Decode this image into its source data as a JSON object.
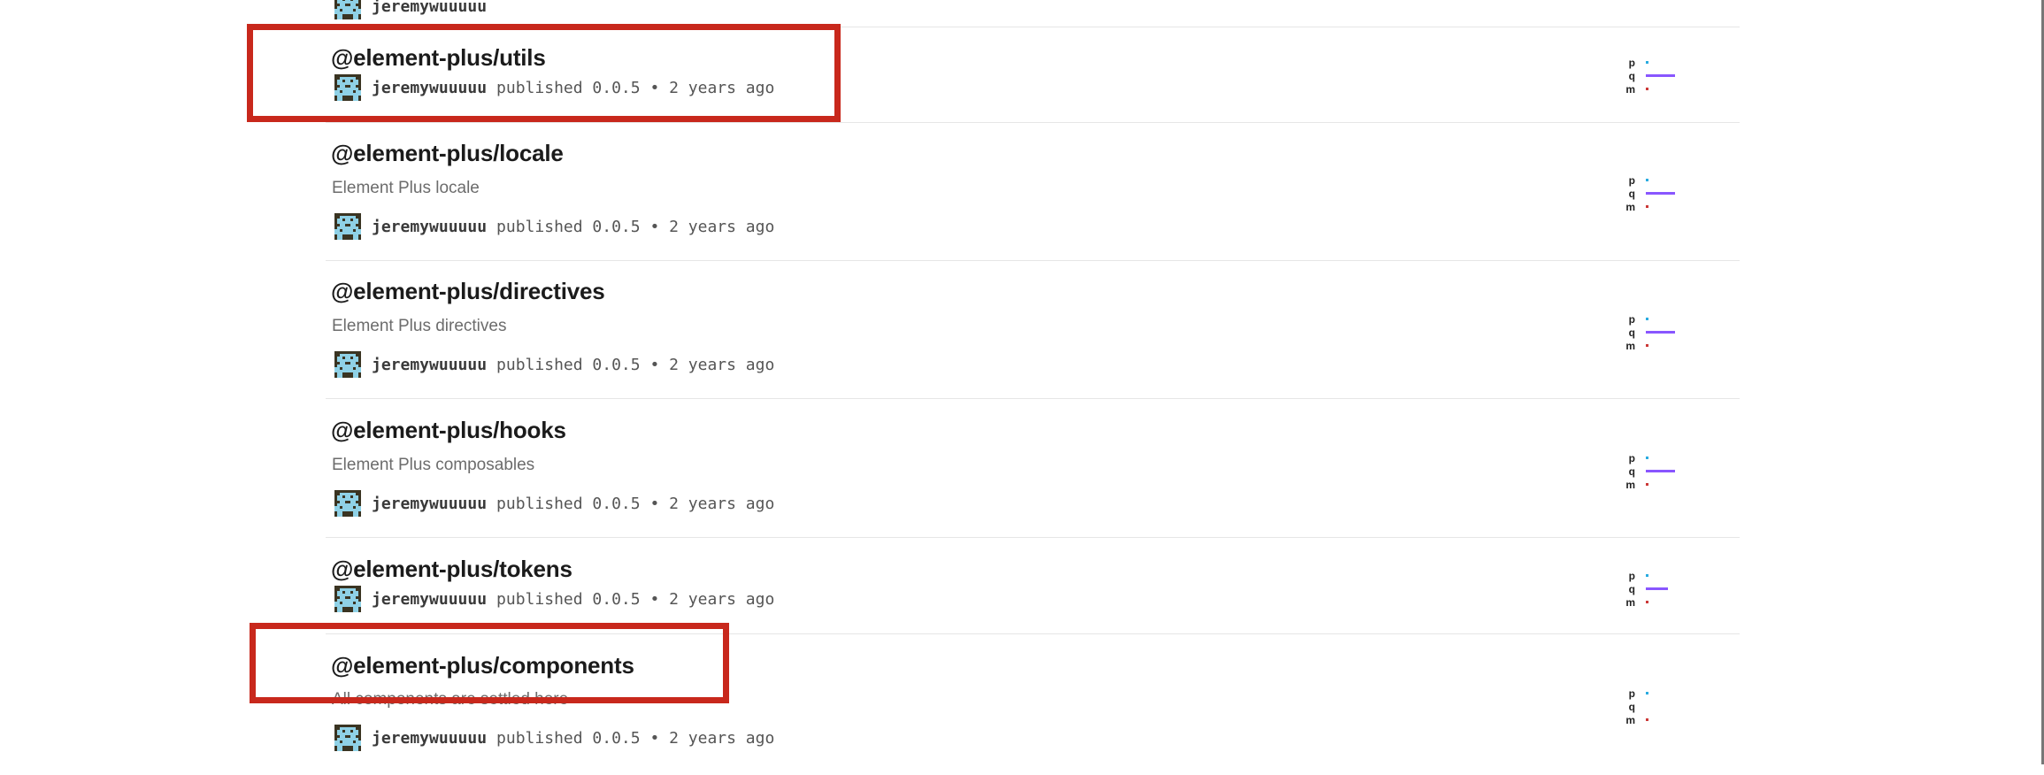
{
  "scores_legend": {
    "p": "p",
    "q": "q",
    "m": "m"
  },
  "colors": {
    "popularity": "#29abe0",
    "quality": "#8956ff",
    "maintenance": "#cb3837",
    "callout": "#c8281c"
  },
  "top_partial_row": {
    "publisher": "jeremywuuuuu"
  },
  "packages": [
    {
      "name": "@element-plus/utils",
      "description": "",
      "publisher": "jeremywuuuuu",
      "published_text": "published 0.0.5 • 2 years ago",
      "scores": {
        "p": 0.05,
        "q": 0.55,
        "m": 0.03
      }
    },
    {
      "name": "@element-plus/locale",
      "description": "Element Plus locale",
      "publisher": "jeremywuuuuu",
      "published_text": "published 0.0.5 • 2 years ago",
      "scores": {
        "p": 0.05,
        "q": 0.55,
        "m": 0.03
      }
    },
    {
      "name": "@element-plus/directives",
      "description": "Element Plus directives",
      "publisher": "jeremywuuuuu",
      "published_text": "published 0.0.5 • 2 years ago",
      "scores": {
        "p": 0.05,
        "q": 0.55,
        "m": 0.03
      }
    },
    {
      "name": "@element-plus/hooks",
      "description": "Element Plus composables",
      "publisher": "jeremywuuuuu",
      "published_text": "published 0.0.5 • 2 years ago",
      "scores": {
        "p": 0.05,
        "q": 0.55,
        "m": 0.03
      }
    },
    {
      "name": "@element-plus/tokens",
      "description": "",
      "publisher": "jeremywuuuuu",
      "published_text": "published 0.0.5 • 2 years ago",
      "scores": {
        "p": 0.04,
        "q": 0.42,
        "m": 0.03
      }
    },
    {
      "name": "@element-plus/components",
      "description": "All components are settled here",
      "publisher": "jeremywuuuuu",
      "published_text": "published 0.0.5 • 2 years ago",
      "scores": {
        "p": 0.04,
        "q": 0.0,
        "m": 0.03
      }
    }
  ]
}
